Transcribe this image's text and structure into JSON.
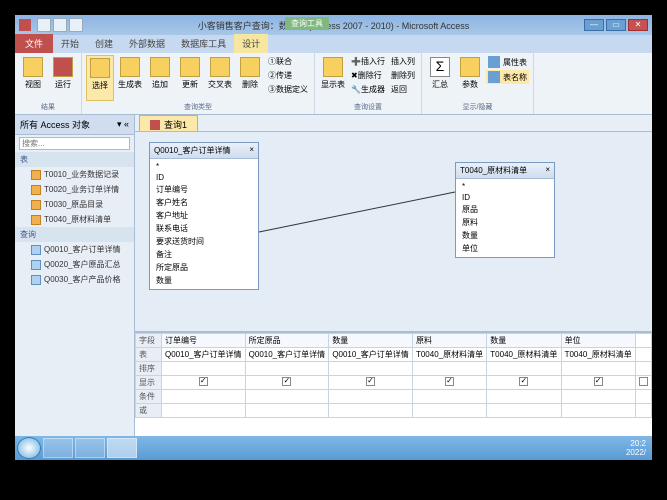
{
  "window": {
    "tool_context": "查询工具",
    "title": "小客销售客户查询：数据库 (Access 2007 - 2010) - Microsoft Access",
    "min": "—",
    "max": "▭",
    "close": "✕"
  },
  "tabs": {
    "file": "文件",
    "items": [
      "开始",
      "创建",
      "外部数据",
      "数据库工具"
    ],
    "ctx": "设计"
  },
  "ribbon": {
    "g1": {
      "view": "视图",
      "run": "运行",
      "label": "结果"
    },
    "g2": {
      "select": "选择",
      "mktbl": "生成表",
      "append": "追加",
      "update": "更新",
      "crosstab": "交叉表",
      "delete": "删除",
      "union": "①联合",
      "passthrough": "②传递",
      "datadef": "③数据定义",
      "label": "查询类型"
    },
    "g3": {
      "insrow": "➕插入行",
      "delrow": "✖删除行",
      "builder": "🔧生成器",
      "inscol": "插入列",
      "delcol": "删除列",
      "return": "返回",
      "showtbl": "显示表",
      "label": "查询设置"
    },
    "g4": {
      "totals": "汇总",
      "params": "参数",
      "propsheet": "属性表",
      "tblnames": "表名称",
      "label": "显示/隐藏"
    }
  },
  "nav": {
    "header": "所有 Access 对象",
    "search_label": "搜索...",
    "search_ph": "",
    "g_tables": "表",
    "tables": [
      "T0010_业务数据记录",
      "T0020_业务订单详情",
      "T0030_原品目录",
      "T0040_原材料清单"
    ],
    "g_queries": "查询",
    "queries": [
      "Q0010_客户订单详情",
      "Q0020_客户原品汇总",
      "Q0030_客户产品价格"
    ]
  },
  "doc": {
    "tab": "查询1",
    "box1": {
      "title": "Q0010_客户订单详情",
      "fields": [
        "*",
        "ID",
        "订单编号",
        "客户姓名",
        "客户地址",
        "联系电话",
        "要求送货时间",
        "备注",
        "所定原品",
        "数量"
      ]
    },
    "box2": {
      "title": "T0040_原材料清单",
      "fields": [
        "*",
        "ID",
        "原品",
        "原料",
        "数量",
        "单位"
      ]
    }
  },
  "qbe": {
    "rows": [
      "字段",
      "表",
      "排序",
      "显示",
      "条件",
      "或"
    ],
    "cols": [
      {
        "field": "订单编号",
        "table": "Q0010_客户订单详情",
        "show": true
      },
      {
        "field": "所定原品",
        "table": "Q0010_客户订单详情",
        "show": true
      },
      {
        "field": "数量",
        "table": "Q0010_客户订单详情",
        "show": true
      },
      {
        "field": "原料",
        "table": "T0040_原材料清单",
        "show": true
      },
      {
        "field": "数量",
        "table": "T0040_原材料清单",
        "show": true
      },
      {
        "field": "单位",
        "table": "T0040_原材料清单",
        "show": true
      }
    ]
  },
  "taskbar": {
    "time": "20:2",
    "date": "2022/"
  }
}
